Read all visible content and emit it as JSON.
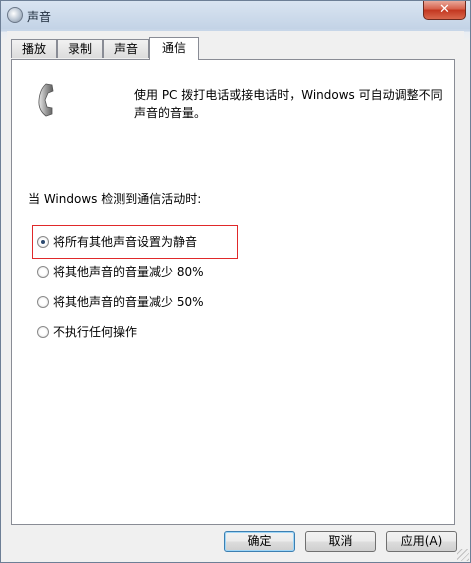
{
  "window": {
    "title": "声音",
    "close_label": "✕"
  },
  "tabs": [
    {
      "label": "播放"
    },
    {
      "label": "录制"
    },
    {
      "label": "声音"
    },
    {
      "label": "通信",
      "active": true
    }
  ],
  "panel": {
    "icon": "telephone-handset-icon",
    "description_line1": "使用 PC 拨打电话或接电话时，Windows 可自动调整不同",
    "description_line2": "声音的音量。",
    "section_label": "当 Windows 检测到通信活动时:",
    "options": [
      {
        "label": "将所有其他声音设置为静音",
        "checked": true
      },
      {
        "label": "将其他声音的音量减少 80%",
        "checked": false
      },
      {
        "label": "将其他声音的音量减少 50%",
        "checked": false
      },
      {
        "label": "不执行任何操作",
        "checked": false
      }
    ],
    "highlight_color": "#e0292a"
  },
  "buttons": {
    "ok": "确定",
    "cancel": "取消",
    "apply": "应用(A)"
  }
}
